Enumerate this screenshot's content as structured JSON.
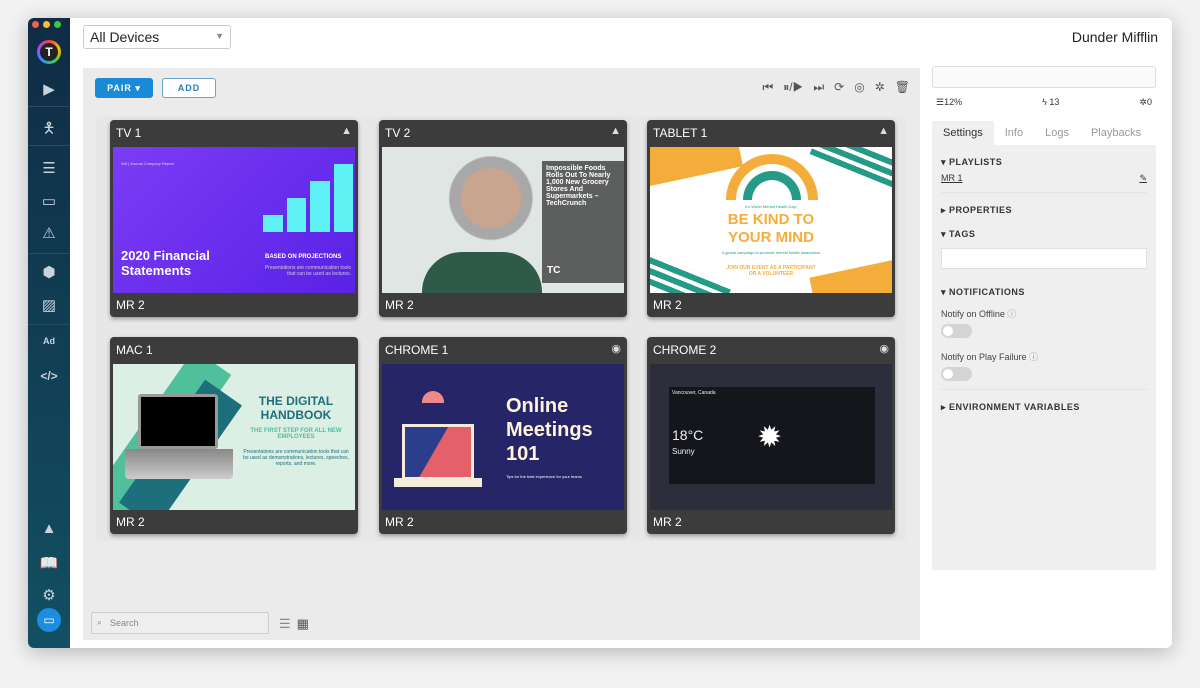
{
  "header": {
    "device_filter": "All Devices",
    "company": "Dunder Mifflin"
  },
  "sidebar": {
    "logo_letter": "T",
    "items": [
      "play",
      "kiosk",
      "playlists",
      "devices",
      "alerts",
      "apps",
      "media",
      "ads",
      "code"
    ],
    "bottom": [
      "analytics",
      "docs",
      "settings",
      "chat"
    ]
  },
  "toolbar": {
    "pair": "PAIR",
    "add": "ADD",
    "icons": [
      "skip-back",
      "pause-play",
      "skip-forward",
      "refresh",
      "fingerprint",
      "debug",
      "delete"
    ]
  },
  "devices": [
    {
      "name": "TV 1",
      "os": "android",
      "playlist": "MR 2",
      "thumb": {
        "sub": "WA | Annual Company Report",
        "title": "2020 Financial Statements",
        "tag": "BASED ON PROJECTIONS",
        "body": "Presentations are communication tools that can be used as lectures.",
        "bars": [
          10,
          20,
          30,
          40
        ]
      }
    },
    {
      "name": "TV 2",
      "os": "android",
      "playlist": "MR 2",
      "thumb": {
        "title": "Impossible Foods Rolls Out To Nearly 1,000 New Grocery Stores And Supermarkets – TechCrunch",
        "logo": "TC"
      }
    },
    {
      "name": "TABLET 1",
      "os": "android",
      "playlist": "MR 2",
      "thumb": {
        "sub": "It's World Mental Health Day!",
        "title": "BE KIND TO YOUR MIND",
        "body": "A global campaign to promote mental health awareness",
        "cta": "JOIN OUR EVENT AS A PARTICIPANT OR A VOLUNTEER"
      }
    },
    {
      "name": "MAC 1",
      "os": "apple",
      "playlist": "MR 2",
      "thumb": {
        "title": "THE DIGITAL HANDBOOK",
        "tag": "THE FIRST STEP FOR ALL NEW EMPLOYEES",
        "body": "Presentations are communication tools that can be used as demonstrations, lectures, speeches, reports, and more."
      }
    },
    {
      "name": "CHROME 1",
      "os": "chrome",
      "playlist": "MR 2",
      "thumb": {
        "title": "Online Meetings 101",
        "body": "Tips for the best experience for your teams"
      }
    },
    {
      "name": "CHROME 2",
      "os": "chrome",
      "playlist": "MR 2",
      "thumb": {
        "city": "Vancouver, Canada",
        "temp": "18°C",
        "cond": "Sunny"
      }
    }
  ],
  "footer": {
    "search_placeholder": "Search"
  },
  "right": {
    "stats": {
      "storage": "12%",
      "power": "13",
      "bugs": "0"
    },
    "tabs": [
      "Settings",
      "Info",
      "Logs",
      "Playbacks"
    ],
    "sections": {
      "playlists": "PLAYLISTS",
      "properties": "PROPERTIES",
      "tags": "TAGS",
      "notifications": "NOTIFICATIONS",
      "env": "ENVIRONMENT VARIABLES"
    },
    "playlist_link": "MR 1",
    "notify_offline": "Notify on Offline",
    "notify_fail": "Notify on Play Failure",
    "notify_offline_on": false,
    "notify_fail_on": false
  }
}
